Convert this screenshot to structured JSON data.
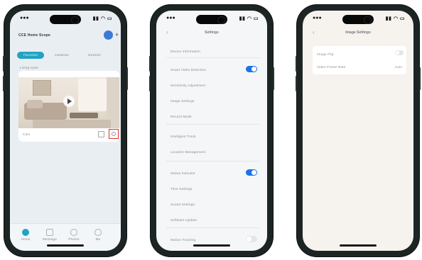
{
  "phone1": {
    "home_title": "CCE Home Scope",
    "tabs": [
      {
        "label": "Favorites"
      },
      {
        "label": "Cameras"
      },
      {
        "label": "Devices"
      }
    ],
    "section_label": "Living room",
    "device_label": "Cam",
    "bottom_tabs": [
      {
        "label": "Home"
      },
      {
        "label": "Message"
      },
      {
        "label": "Photos"
      },
      {
        "label": "Me"
      }
    ]
  },
  "phone2": {
    "title": "Settings",
    "rows": [
      {
        "label": "Device Information"
      },
      {
        "label": "Smart Video Detection"
      },
      {
        "label": "Sensitivity Adjustment"
      },
      {
        "label": "Image Settings"
      },
      {
        "label": "Record Mode"
      },
      {
        "label": "Intelligent Track"
      },
      {
        "label": "Location Management"
      },
      {
        "label": "Status Indicator"
      },
      {
        "label": "Time Settings"
      },
      {
        "label": "Sound Settings"
      },
      {
        "label": "Software Update"
      },
      {
        "label": "Motion Tracking"
      }
    ]
  },
  "phone3": {
    "title": "Image Settings",
    "rows": [
      {
        "label": "Image Flip",
        "value": ""
      },
      {
        "label": "Video Frame Rate",
        "value": "Auto"
      }
    ]
  },
  "colors": {
    "accent": "#1a73e8",
    "highlight": "#d9322e",
    "frame": "#1d2424"
  }
}
